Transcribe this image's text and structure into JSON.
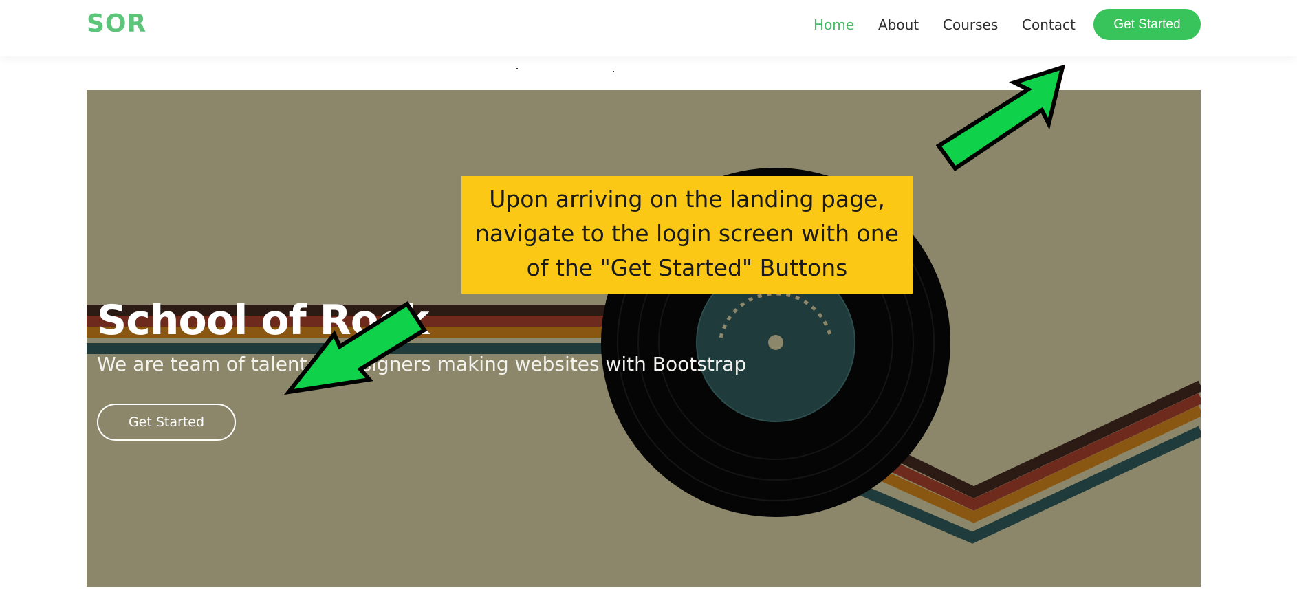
{
  "header": {
    "logo": "SOR",
    "nav": [
      {
        "label": "Home",
        "active": true
      },
      {
        "label": "About",
        "active": false
      },
      {
        "label": "Courses",
        "active": false
      },
      {
        "label": "Contact",
        "active": false
      }
    ],
    "cta_label": "Get Started"
  },
  "hero": {
    "title": "School of Rock",
    "subtitle": "We are team of talented designers making websites with Bootstrap",
    "cta_label": "Get Started",
    "background_color": "#8c876a"
  },
  "annotation": {
    "callout_text": "Upon arriving on the landing page, navigate to the login screen with one of the \"Get Started\" Buttons",
    "callout_color": "#fbc816",
    "arrow_color": "#0fd24a"
  },
  "colors": {
    "brand": "#5cc57a",
    "cta": "#38c35b",
    "nav_active": "#47b964"
  }
}
